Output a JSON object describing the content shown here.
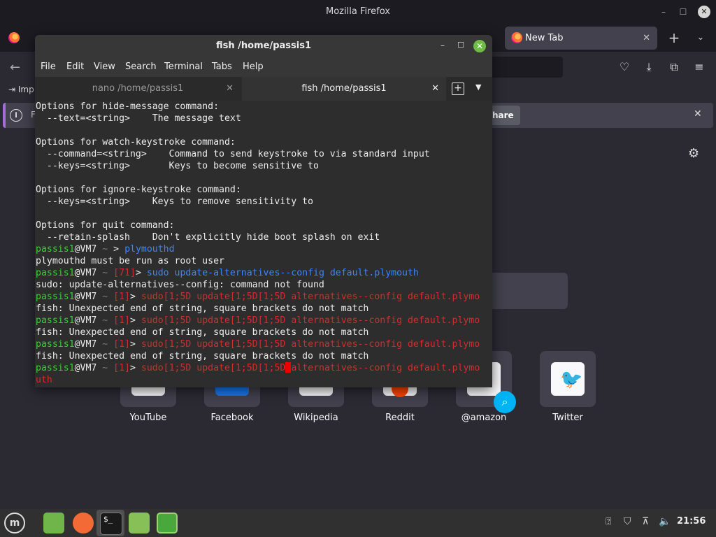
{
  "firefox": {
    "window_title": "Mozilla Firefox",
    "tab_label": "New Tab",
    "bookmark_import": "Imp",
    "notification_prefix": "F",
    "notification_button": "hare",
    "shortcuts": [
      {
        "label": "YouTube"
      },
      {
        "label": "Facebook"
      },
      {
        "label": "Wikipedia"
      },
      {
        "label": "Reddit"
      },
      {
        "label": "@amazon"
      },
      {
        "label": "Twitter"
      }
    ]
  },
  "terminal": {
    "title": "fish /home/passis1",
    "menu": [
      "File",
      "Edit",
      "View",
      "Search",
      "Terminal",
      "Tabs",
      "Help"
    ],
    "tabs": [
      {
        "label": "nano /home/passis1"
      },
      {
        "label": "fish /home/passis1"
      }
    ],
    "lines": [
      {
        "text": "Options for hide-message command:"
      },
      {
        "text": "  --text=<string>    The message text"
      },
      {
        "text": ""
      },
      {
        "text": "Options for watch-keystroke command:"
      },
      {
        "text": "  --command=<string>    Command to send keystroke to via standard input"
      },
      {
        "text": "  --keys=<string>       Keys to become sensitive to"
      },
      {
        "text": ""
      },
      {
        "text": "Options for ignore-keystroke command:"
      },
      {
        "text": "  --keys=<string>    Keys to remove sensitivity to"
      },
      {
        "text": ""
      },
      {
        "text": "Options for quit command:"
      },
      {
        "text": "  --retain-splash    Don't explicitly hide boot splash on exit"
      }
    ],
    "prompt_user": "passis1",
    "prompt_host": "@VM7",
    "prompt_dir": " ~ ",
    "prompt_arrow": "> ",
    "history": [
      {
        "status": "",
        "command": "plymouthd"
      },
      {
        "output": "plymouthd must be run as root user"
      },
      {
        "status": "[71]",
        "command": "sudo update-alternatives--config default.plymouth"
      },
      {
        "output": "sudo: update-alternatives--config: command not found"
      },
      {
        "status": "[1]",
        "command": "sudo[1;5D update[1;5D[1;5D alternatives--config default.plymo"
      },
      {
        "output": "fish: Unexpected end of string, square brackets do not match"
      },
      {
        "status": "[1]",
        "command": "sudo[1;5D update[1;5D[1;5D alternatives--config default.plymo"
      },
      {
        "output": "fish: Unexpected end of string, square brackets do not match"
      },
      {
        "status": "[1]",
        "command": "sudo[1;5D update[1;5D[1;5D alternatives--config default.plymo"
      },
      {
        "output": "fish: Unexpected end of string, square brackets do not match"
      },
      {
        "status": "[1]",
        "command_before_cursor": "sudo[1;5D update[1;5D[1;5D",
        "command_after_cursor": "alternatives--config default.plymo"
      },
      {
        "wrap": "uth"
      }
    ]
  },
  "panel": {
    "clock": "21:56"
  },
  "colors": {
    "prompt_user": "#32d232",
    "valid_command": "#3a86ff",
    "invalid_command": "#d42c2c",
    "firefox_bg": "#2b2a33",
    "terminal_bg": "#2d2d2d",
    "mint_accent": "#6ebc46"
  }
}
